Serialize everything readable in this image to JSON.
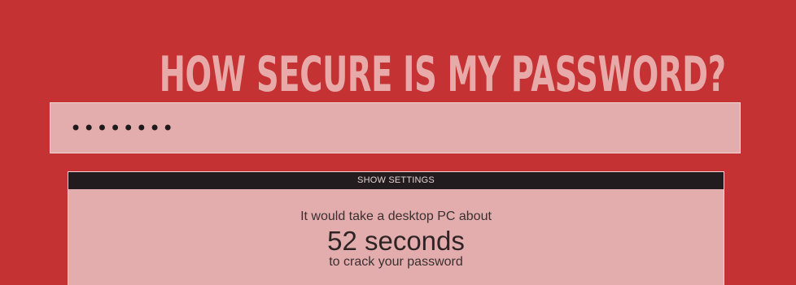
{
  "header": {
    "title": "HOW SECURE IS MY PASSWORD?"
  },
  "password_field": {
    "value": "••••••••",
    "input_type": "password"
  },
  "settings": {
    "toggle_label": "SHOW SETTINGS"
  },
  "result": {
    "prefix": "It would take a desktop PC about",
    "time": "52 seconds",
    "suffix": "to crack your password"
  },
  "colors": {
    "background": "#c43234",
    "title": "#e8aaa9",
    "panel": "#e4adad",
    "settings_bar": "#231c1f"
  }
}
